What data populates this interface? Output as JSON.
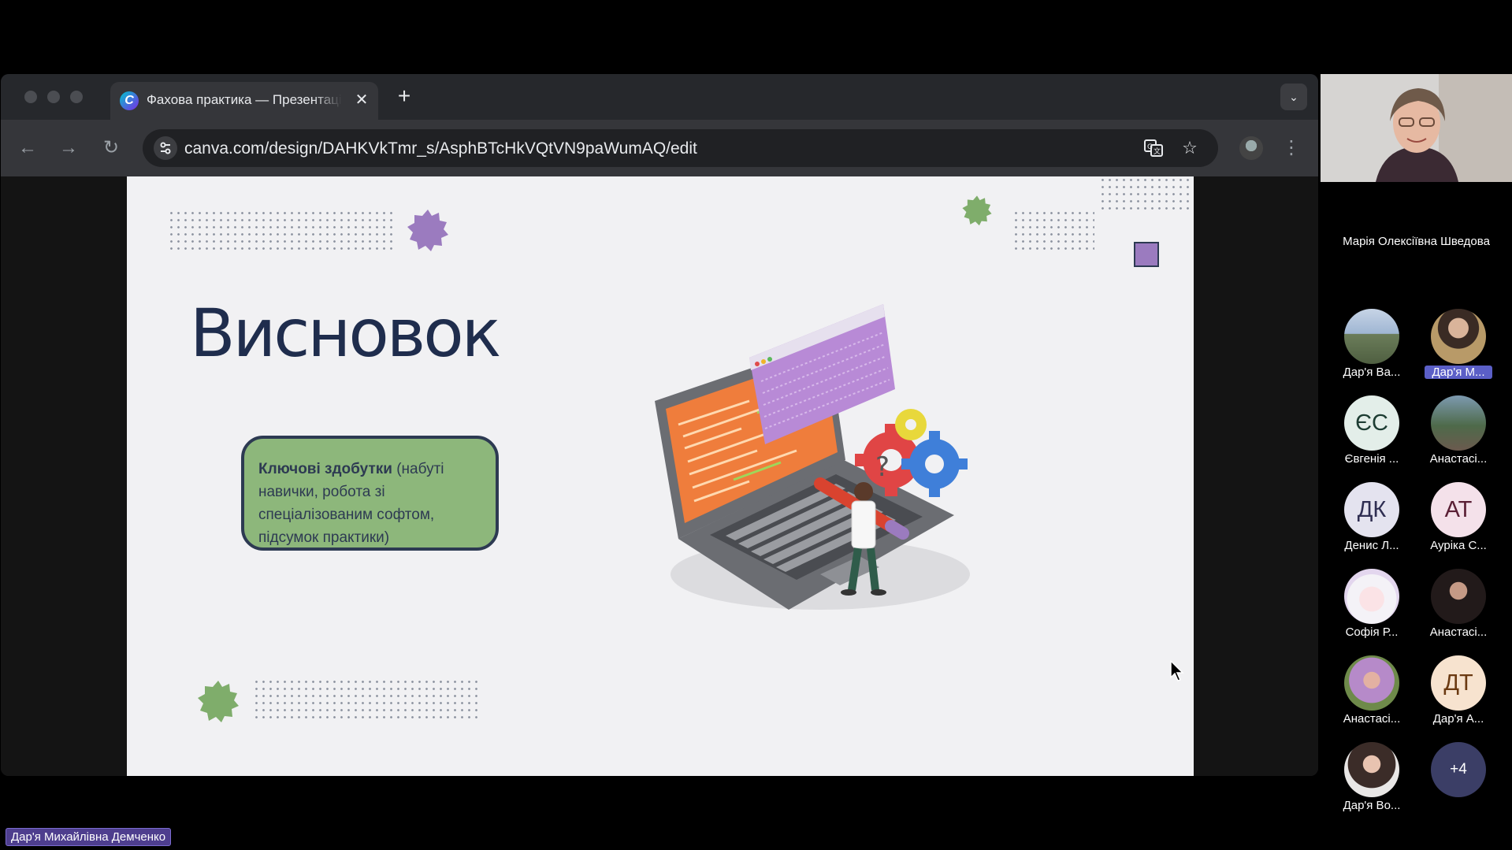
{
  "browser": {
    "tab": {
      "title": "Фахова практика — Презентація",
      "favicon": "canva-logo",
      "close_icon": "close-icon"
    },
    "new_tab_icon": "plus-icon",
    "tab_menu_icon": "chevron-down-icon",
    "url": "canva.com/design/DAHKVkTmr_s/AsphBTcHkVQtVN9paWumAQ/edit"
  },
  "slide": {
    "title": "Висновок",
    "callout_bold": "Ключові здобутки",
    "callout_rest": " (набуті навички, робота зі спеціалізованим софтом, підсумок практики)"
  },
  "speaker": {
    "name": "Марія Олексіївна Шведова"
  },
  "participants": [
    {
      "name": "Дар'я Ва...",
      "initials": "",
      "avatar": "photo-landscape"
    },
    {
      "name": "Дар'я М...",
      "initials": "",
      "avatar": "photo-portrait",
      "highlighted": true
    },
    {
      "name": "Євгенія ...",
      "initials": "ЄС",
      "avatar_bg": "#e3eee9",
      "avatar_fg": "#1d3d33"
    },
    {
      "name": "Анастасі...",
      "initials": "",
      "avatar": "photo-outdoor"
    },
    {
      "name": "Денис Л...",
      "initials": "ДК",
      "avatar_bg": "#e4e3ef",
      "avatar_fg": "#2f2e52"
    },
    {
      "name": "Аурiка С...",
      "initials": "АТ",
      "avatar_bg": "#f4e1ea",
      "avatar_fg": "#5a1f35"
    },
    {
      "name": "Софія Р...",
      "initials": "",
      "avatar": "photo-anime"
    },
    {
      "name": "Анастасі...",
      "initials": "",
      "avatar": "photo-dark"
    },
    {
      "name": "Анастасі...",
      "initials": "",
      "avatar": "photo-pink"
    },
    {
      "name": "Дар'я А...",
      "initials": "ДТ",
      "avatar_bg": "#f7e3cf",
      "avatar_fg": "#6b3a12"
    },
    {
      "name": "Дар'я Во...",
      "initials": "",
      "avatar": "photo-girl"
    }
  ],
  "more_participants": "+4",
  "self_label": "Дар'я Михайлівна Демченко",
  "colors": {
    "accent_purple": "#9b7bbf",
    "accent_green": "#8db77b",
    "navy": "#1f2d4d",
    "chip": "#4e3e8e"
  }
}
